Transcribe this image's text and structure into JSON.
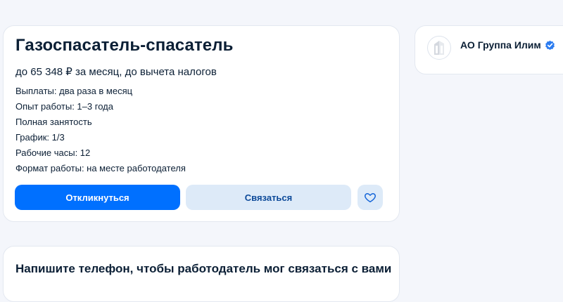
{
  "vacancy": {
    "title": "Газоспасатель-спасатель",
    "salary": "до 65 348 ₽ за месяц, до вычета налогов",
    "details": [
      "Выплаты: два раза в месяц",
      "Опыт работы: 1–3 года",
      "Полная занятость",
      "График: 1/3",
      "Рабочие часы: 12",
      "Формат работы: на месте работодателя"
    ],
    "respond_label": "Откликнуться",
    "contact_label": "Связаться",
    "favorite_icon": "heart-icon"
  },
  "employer": {
    "name": "АО Группа Илим",
    "verified_icon": "verified-check-icon"
  },
  "phone_block": {
    "title": "Напишите телефон, чтобы работодатель мог связаться с вами"
  },
  "colors": {
    "primary": "#0070ff",
    "secondary_bg": "#ddeaf8",
    "verified": "#2b7cf0",
    "page_bg": "#f4f6fb"
  }
}
